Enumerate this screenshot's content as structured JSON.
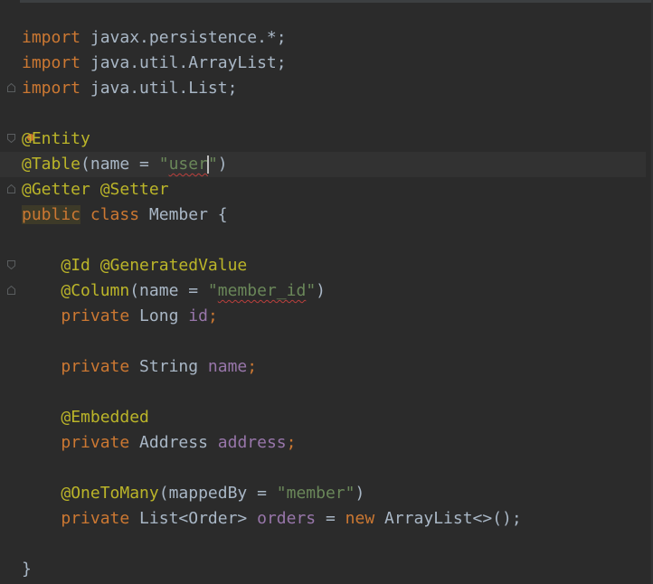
{
  "colors": {
    "background": "#2b2b2b",
    "keyword": "#cc7832",
    "annotation": "#bbb529",
    "string": "#6a8759",
    "field": "#9876aa",
    "text": "#a9b7c6",
    "error_underline": "#bc3f3c"
  },
  "lines": {
    "l1": {
      "kw": "import",
      "rest": " javax.persistence.*;"
    },
    "l2": {
      "kw": "import",
      "rest": " java.util.ArrayList;"
    },
    "l3": {
      "kw": "import",
      "rest": " java.util.List;"
    },
    "l5": {
      "ann": "@Entity"
    },
    "l6": {
      "ann": "@Table",
      "open": "(name = ",
      "q1": "\"",
      "str_a": "user",
      "q2": "\"",
      "close": ")"
    },
    "l7": {
      "ann": "@Getter @Setter"
    },
    "l8": {
      "kw1": "public",
      "kw2": " class",
      "rest": " Member {"
    },
    "l10": {
      "ann": "@Id @GeneratedValue"
    },
    "l11": {
      "ann": "@Column",
      "open": "(name = ",
      "q1": "\"",
      "str": "member_id",
      "q2": "\"",
      "close": ")"
    },
    "l12": {
      "kw": "private",
      "type": " Long ",
      "field": "id",
      "end": ";"
    },
    "l14": {
      "kw": "private",
      "type": " String ",
      "field": "name",
      "end": ";"
    },
    "l16": {
      "ann": "@Embedded"
    },
    "l17": {
      "kw": "private",
      "type": " Address ",
      "field": "address",
      "end": ";"
    },
    "l19": {
      "ann": "@OneToMany",
      "open": "(mappedBy = ",
      "str": "\"member\"",
      "close": ")"
    },
    "l20": {
      "kw": "private",
      "type": " List<Order> ",
      "field": "orders",
      "mid": " = ",
      "kw2": "new",
      "rest": " ArrayList<>();"
    },
    "l22": {
      "brace": "}"
    }
  },
  "icons": [
    "fold-marker-icon",
    "intention-bulb-icon",
    "text-caret"
  ]
}
